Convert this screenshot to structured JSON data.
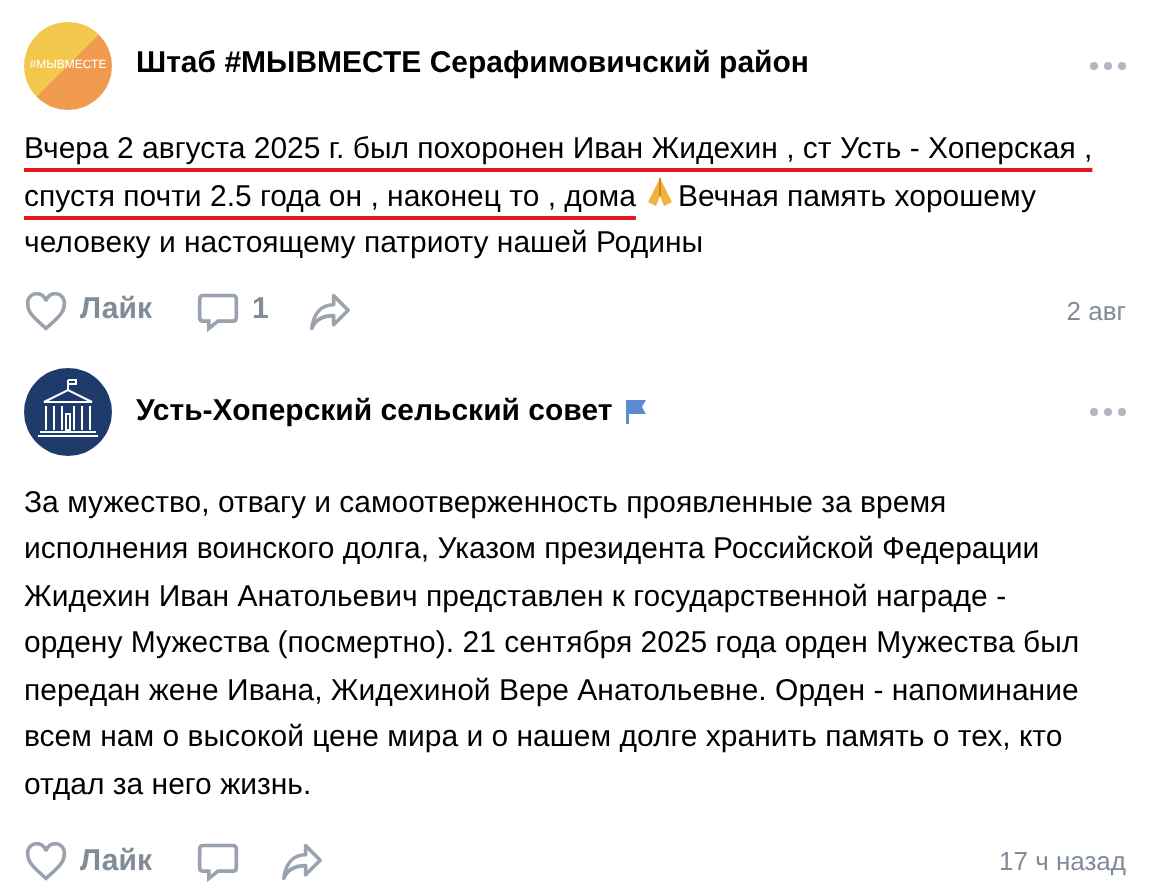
{
  "posts": [
    {
      "author": "Штаб #МЫВМЕСТЕ Серафимовичский район",
      "avatar": {
        "kind": "badge",
        "text": "#МЫВМЕСТЕ"
      },
      "verified": false,
      "text": [
        {
          "text": "Вчера 2 августа 2025 г. был похоронен Иван Жидехин , ст Усть - Хоперская , спустя почти 2.5 года он , наконец то , дома",
          "underlined": true
        },
        {
          "text": "Вечная память хорошему человеку и настоящему патриоту нашей Родины",
          "underlined": false,
          "emoji": true
        }
      ],
      "like_label": "Лайк",
      "comments": "1",
      "time": "2 авг"
    },
    {
      "author": "Усть-Хоперский сельский совет",
      "avatar": {
        "kind": "building"
      },
      "verified": true,
      "text": [
        {
          "text": "За мужество, отвагу и самоотверженность проявленные за время исполнения воинского долга, Указом президента Российской Федерации Жидехин Иван Анатольевич представлен к государственной награде - ордену Мужества (посмертно). 21 сентября 2025 года орден Мужества был передан жене Ивана, Жидехиной Вере Анатольевне.  Орден -  напоминание всем нам о высокой цене мира и о нашем долге хранить память о тех, кто отдал за него жизнь.",
          "underlined": false
        }
      ],
      "like_label": "Лайк",
      "time": "17 ч назад"
    }
  ]
}
